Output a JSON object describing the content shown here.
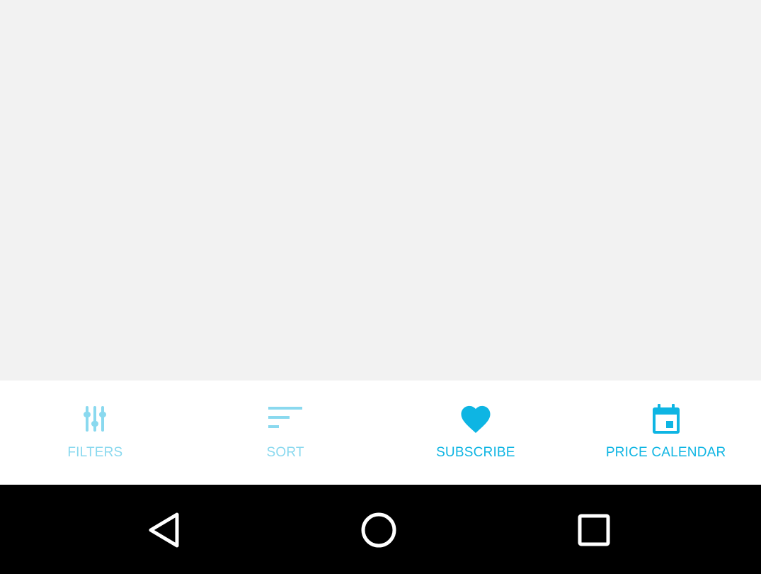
{
  "bottom_bar": {
    "items": [
      {
        "label": "FILTERS",
        "icon": "sliders-icon",
        "color": "#8ad9ef"
      },
      {
        "label": "SORT",
        "icon": "sort-lines-icon",
        "color": "#8ad9ef"
      },
      {
        "label": "SUBSCRIBE",
        "icon": "heart-icon",
        "color": "#0eb5e3"
      },
      {
        "label": "PRICE CALENDAR",
        "icon": "calendar-icon",
        "color": "#0eb5e3"
      }
    ]
  },
  "system_nav": {
    "buttons": [
      {
        "icon": "back-triangle-icon"
      },
      {
        "icon": "home-circle-icon"
      },
      {
        "icon": "recents-square-icon"
      }
    ]
  },
  "colors": {
    "content_background": "#f2f2f2",
    "bar_background": "#ffffff",
    "nav_background": "#000000",
    "accent": "#0eb5e3",
    "accent_light": "#8ad9ef"
  }
}
